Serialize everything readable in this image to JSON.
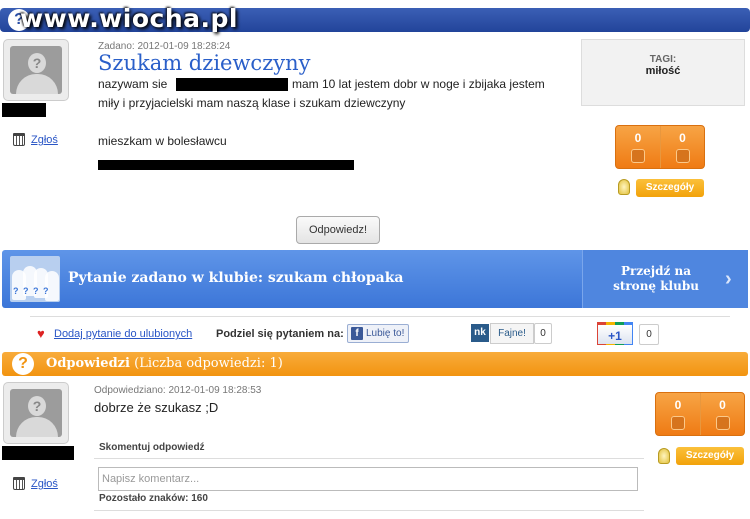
{
  "watermark": "www.wiocha.pl",
  "question": {
    "meta": "Zadano: 2012-01-09 18:28:24",
    "title": "Szukam dziewczyny",
    "line1a": "nazywam sie",
    "line1b": "mam 10 lat jestem dobr w noge i zbijaka jestem",
    "line2": "miły i przyjacielski mam naszą klase i szukam dziewczyny",
    "line3": "mieszkam w bolesławcu",
    "report_label": "Zgłoś",
    "votes": {
      "up": "0",
      "down": "0"
    },
    "details_label": "Szczegóły"
  },
  "tags": {
    "label": "TAGI:",
    "value": "miłość"
  },
  "answer_button": "Odpowiedz!",
  "club": {
    "icon_text": "? ? ? ?",
    "text": "Pytanie zadano w klubie: szukam chłopaka",
    "link_line1": "Przejdź na",
    "link_line2": "stronę klubu"
  },
  "share": {
    "favorite": "Dodaj pytanie do ulubionych",
    "share_label": "Podziel się pytaniem na:",
    "fb_label": "Lubię to!",
    "nk_logo": "nk",
    "nk_label": "Fajne!",
    "nk_count": "0",
    "gplus_label": "+1",
    "gplus_count": "0"
  },
  "answers": {
    "title": "Odpowiedzi",
    "count": "(Liczba odpowiedzi: 1)",
    "items": [
      {
        "meta": "Odpowiedziano: 2012-01-09 18:28:53",
        "text": "dobrze że szukasz ;D",
        "votes": {
          "up": "0",
          "down": "0"
        },
        "details_label": "Szczegóły",
        "report_label": "Zgłoś"
      }
    ]
  },
  "comment": {
    "header": "Skomentuj odpowiedź",
    "placeholder": "Napisz komentarz...",
    "remaining": "Pozostało znaków: 160"
  }
}
